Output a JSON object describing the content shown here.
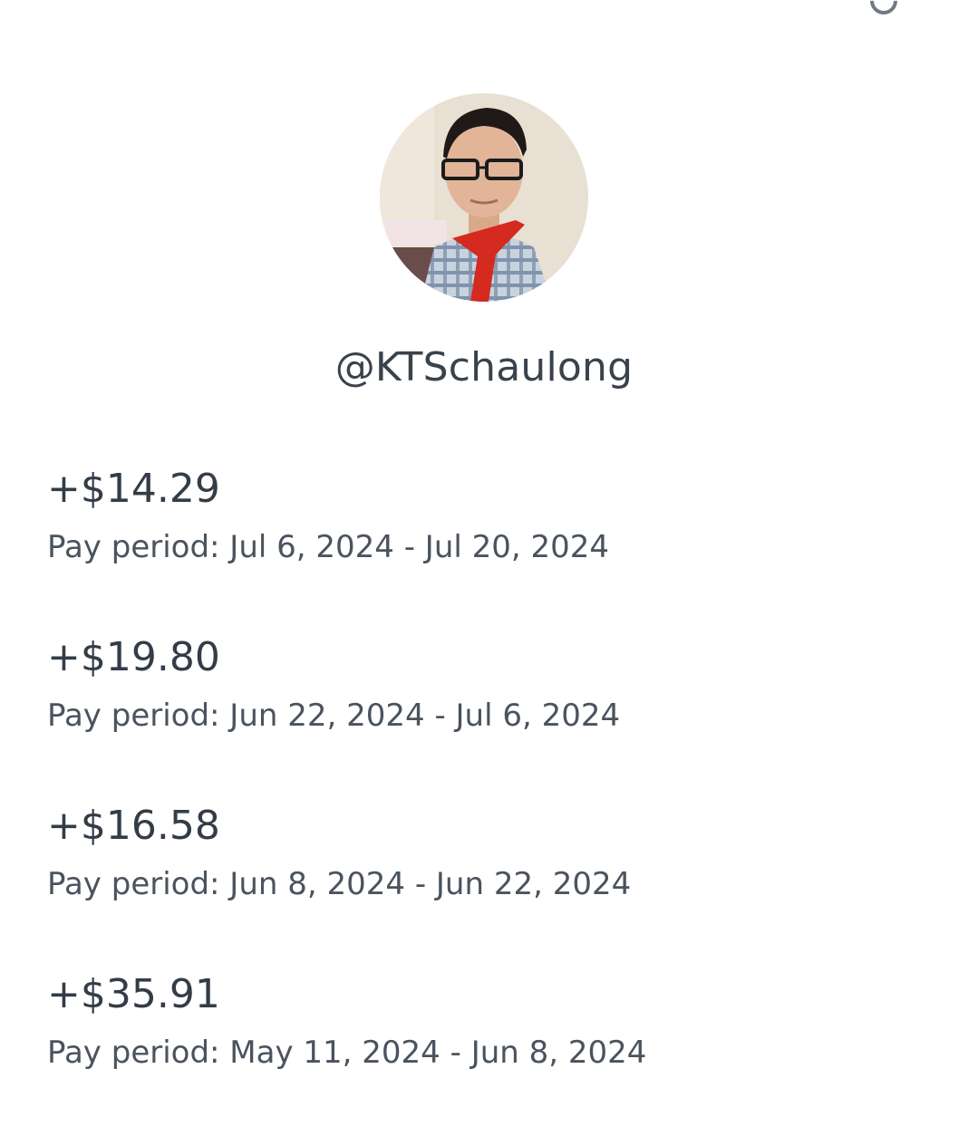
{
  "profile": {
    "handle": "@KTSchaulong",
    "avatar_icon": "profile-photo"
  },
  "payouts": [
    {
      "amount": "+$14.29",
      "period": "Pay period: Jul 6, 2024 - Jul 20, 2024"
    },
    {
      "amount": "+$19.80",
      "period": "Pay period: Jun 22, 2024 - Jul 6, 2024"
    },
    {
      "amount": "+$16.58",
      "period": "Pay period: Jun 8, 2024 - Jun 22, 2024"
    },
    {
      "amount": "+$35.91",
      "period": "Pay period: May 11, 2024 - Jun 8, 2024"
    }
  ],
  "colors": {
    "background": "#ffffff",
    "text_primary": "#333c47",
    "text_secondary": "#4a535e"
  }
}
